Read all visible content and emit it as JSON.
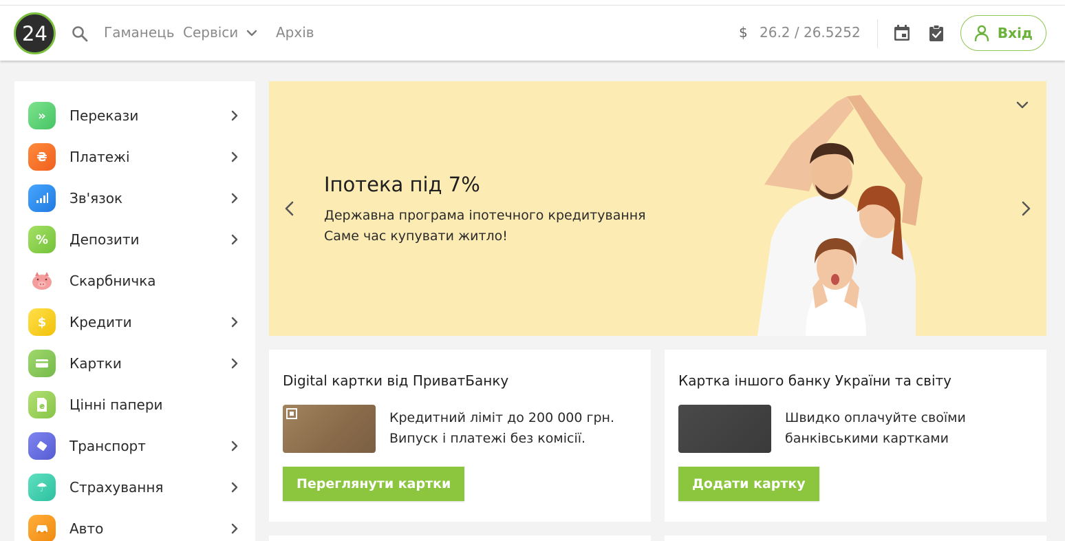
{
  "header": {
    "logo_text": "24",
    "nav": {
      "wallet": "Гаманець",
      "services": "Сервіси",
      "archive": "Архів"
    },
    "rate_currency": "$",
    "rate_value": "26.2 / 26.5252",
    "login_label": "Вхід",
    "accent_color": "#8cc63f"
  },
  "sidebar": {
    "items": [
      {
        "label": "Перекази",
        "icon": "transfers-icon",
        "symbol": "»",
        "color": "#5fd078",
        "has_chevron": true
      },
      {
        "label": "Платежі",
        "icon": "payments-icon",
        "symbol": "₴",
        "color": "#f7742d",
        "has_chevron": true
      },
      {
        "label": "Зв'язок",
        "icon": "mobile-signal-icon",
        "symbol": "",
        "color": "#2f8ff0",
        "has_chevron": true
      },
      {
        "label": "Депозити",
        "icon": "deposits-icon",
        "symbol": "%",
        "color": "#8ad34c",
        "has_chevron": true
      },
      {
        "label": "Скарбничка",
        "icon": "piggy-bank-icon",
        "symbol": "",
        "color": "#f6a0a0",
        "has_chevron": false
      },
      {
        "label": "Кредити",
        "icon": "credits-icon",
        "symbol": "$",
        "color": "#f5cf22",
        "has_chevron": true
      },
      {
        "label": "Картки",
        "icon": "cards-icon",
        "symbol": "",
        "color": "#8ccc5a",
        "has_chevron": true
      },
      {
        "label": "Цінні папери",
        "icon": "securities-icon",
        "symbol": "₴",
        "color": "#9bd45d",
        "has_chevron": false
      },
      {
        "label": "Транспорт",
        "icon": "transport-icon",
        "symbol": "",
        "color": "#6a70e0",
        "has_chevron": true
      },
      {
        "label": "Страхування",
        "icon": "insurance-icon",
        "symbol": "☂",
        "color": "#3fd0b0",
        "has_chevron": true
      },
      {
        "label": "Авто",
        "icon": "car-icon",
        "symbol": "",
        "color": "#f79a1a",
        "has_chevron": true
      }
    ]
  },
  "banner": {
    "title": "Іпотека під 7%",
    "line1": "Державна програма іпотечного кредитування",
    "line2": "Саме час купувати житло!",
    "background": "#fcecb4"
  },
  "cards": {
    "left": {
      "title": "Digital картки від ПриватБанку",
      "text1": "Кредитний ліміт до 200 000 грн.",
      "text2": "Випуск і платежі без комісії.",
      "button": "Переглянути картки"
    },
    "right": {
      "title": "Картка іншого банку України та світу",
      "text1": "Швидко оплачуйте своїми",
      "text2": "банківськими картками",
      "button": "Додати картку"
    }
  }
}
